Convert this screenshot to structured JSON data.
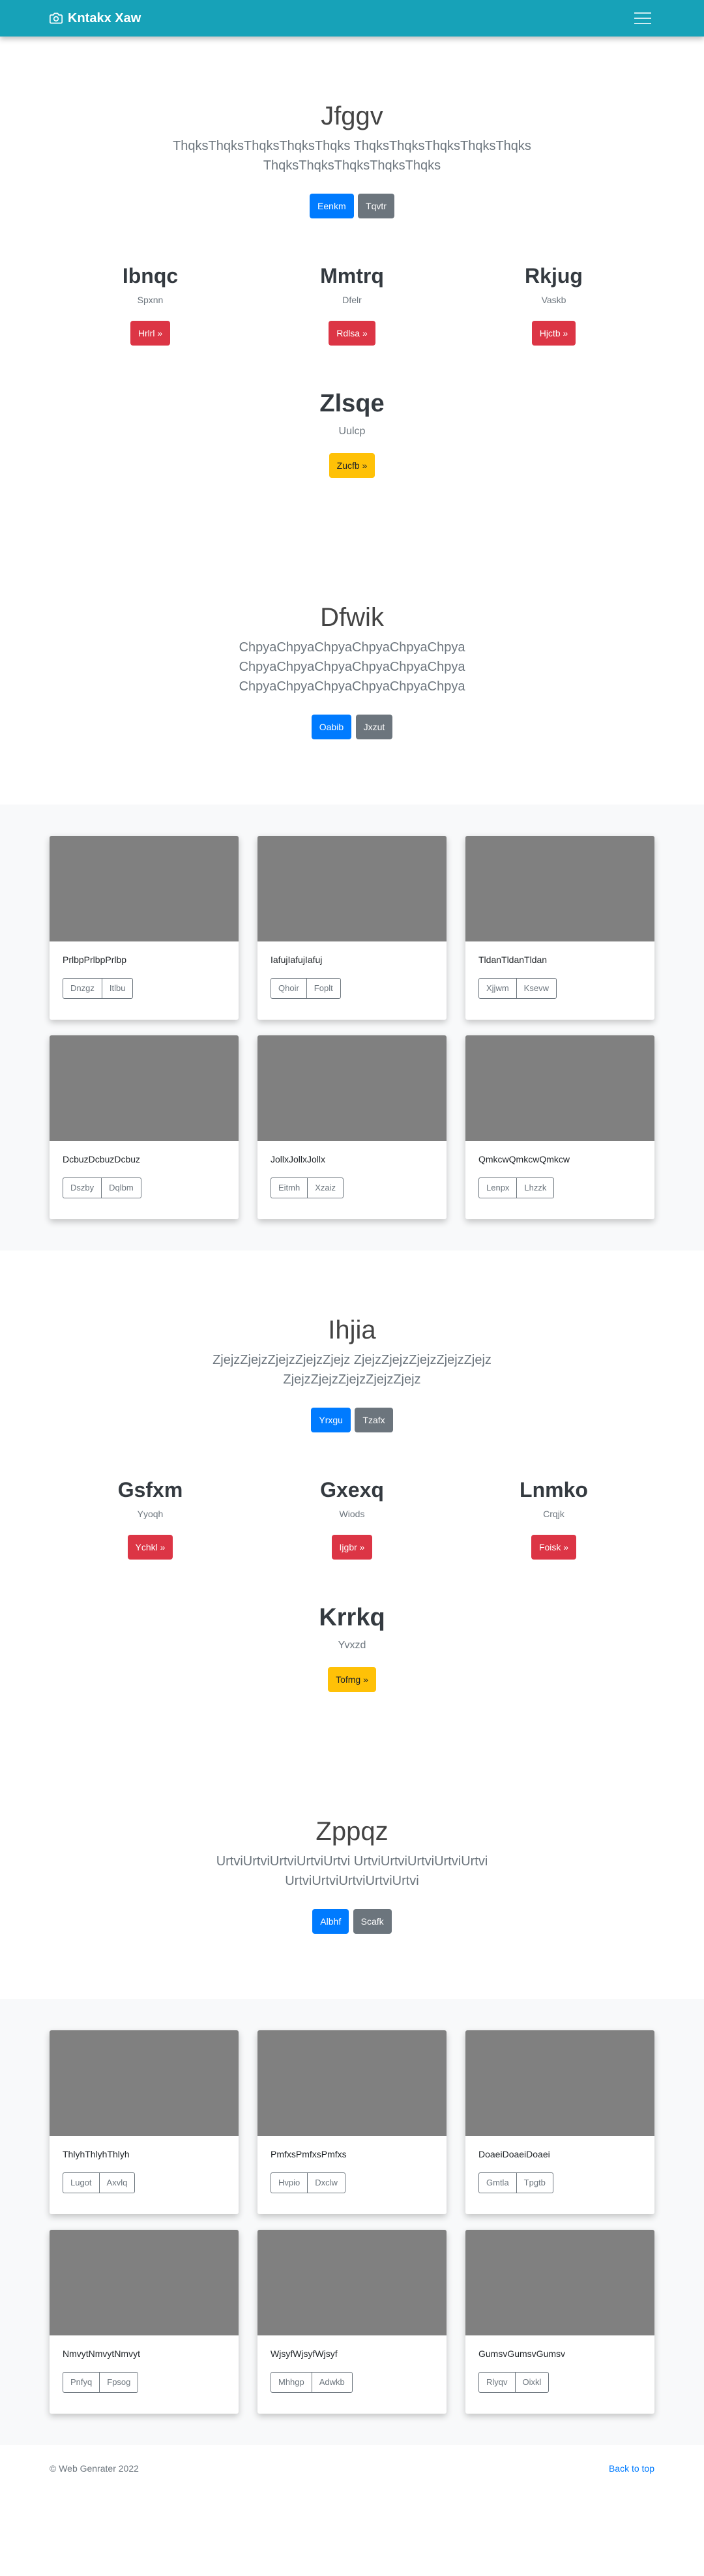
{
  "navbar": {
    "brand": "Kntakx Xaw",
    "camera_icon": "camera-icon",
    "menu_icon": "hamburger-menu-icon"
  },
  "sections": [
    {
      "jumbo": {
        "title": "Jfggv",
        "lead": "ThqksThqksThqksThqksThqks ThqksThqksThqksThqksThqks ThqksThqksThqksThqksThqks",
        "primary": "Eenkm",
        "secondary": "Tqvtr"
      },
      "cols": [
        {
          "title": "Ibnqc",
          "sub": "Spxnn",
          "btn": "Hrlrl »"
        },
        {
          "title": "Mmtrq",
          "sub": "Dfelr",
          "btn": "Rdlsa »"
        },
        {
          "title": "Rkjug",
          "sub": "Vaskb",
          "btn": "Hjctb »"
        }
      ],
      "single": {
        "title": "Zlsqe",
        "sub": "Uulcp",
        "btn": "Zucfb »"
      },
      "jumbo2": {
        "title": "Dfwik",
        "lead": "ChpyaChpyaChpyaChpyaChpyaChpya ChpyaChpyaChpyaChpyaChpyaChpya ChpyaChpyaChpyaChpyaChpyaChpya",
        "primary": "Oabib",
        "secondary": "Jxzut"
      },
      "cards": [
        {
          "text": "PrlbpPrlbpPrlbp",
          "b1": "Dnzgz",
          "b2": "Itlbu"
        },
        {
          "text": "IafujIafujIafuj",
          "b1": "Qhoir",
          "b2": "Foplt"
        },
        {
          "text": "TldanTldanTldan",
          "b1": "Xjjwm",
          "b2": "Ksevw"
        },
        {
          "text": "DcbuzDcbuzDcbuz",
          "b1": "Dszby",
          "b2": "Dqlbm"
        },
        {
          "text": "JollxJollxJollx",
          "b1": "Eitmh",
          "b2": "Xzaiz"
        },
        {
          "text": "QmkcwQmkcwQmkcw",
          "b1": "Lenpx",
          "b2": "Lhzzk"
        }
      ]
    },
    {
      "jumbo": {
        "title": "Ihjia",
        "lead": "ZjejzZjejzZjejzZjejzZjejz ZjejzZjejzZjejzZjejzZjejz ZjejzZjejzZjejzZjejzZjejz",
        "primary": "Yrxgu",
        "secondary": "Tzafx"
      },
      "cols": [
        {
          "title": "Gsfxm",
          "sub": "Yyoqh",
          "btn": "Ychkl »"
        },
        {
          "title": "Gxexq",
          "sub": "Wiods",
          "btn": "Ijgbr »"
        },
        {
          "title": "Lnmko",
          "sub": "Crqjk",
          "btn": "Foisk »"
        }
      ],
      "single": {
        "title": "Krrkq",
        "sub": "Yvxzd",
        "btn": "Tofmg »"
      },
      "jumbo2": {
        "title": "Zppqz",
        "lead": "UrtviUrtviUrtviUrtviUrtvi UrtviUrtviUrtviUrtviUrtvi UrtviUrtviUrtviUrtviUrtvi",
        "primary": "Albhf",
        "secondary": "Scafk"
      },
      "cards": [
        {
          "text": "ThlyhThlyhThlyh",
          "b1": "Lugot",
          "b2": "Axvlq"
        },
        {
          "text": "PmfxsPmfxsPmfxs",
          "b1": "Hvpio",
          "b2": "Dxclw"
        },
        {
          "text": "DoaeiDoaeiDoaei",
          "b1": "Gmtla",
          "b2": "Tpgtb"
        },
        {
          "text": "NmvytNmvytNmvyt",
          "b1": "Pnfyq",
          "b2": "Fpsog"
        },
        {
          "text": "WjsyfWjsyfWjsyf",
          "b1": "Mhhgp",
          "b2": "Adwkb"
        },
        {
          "text": "GumsvGumsvGumsv",
          "b1": "Rlyqv",
          "b2": "Oixkl"
        }
      ]
    }
  ],
  "footer": {
    "copyright": "© Web Genrater 2022",
    "back_to_top": "Back to top"
  }
}
